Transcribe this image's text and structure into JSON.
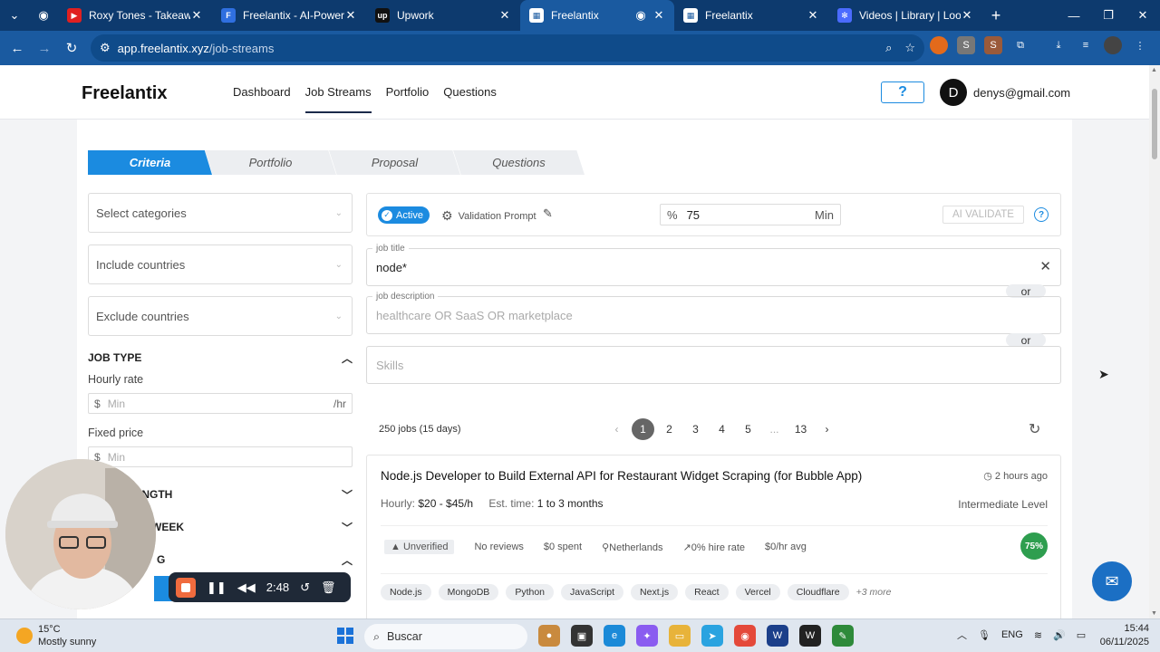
{
  "browser": {
    "tabs": [
      {
        "label": "Roxy Tones - Takeaways |",
        "icon": "youtube-icon",
        "color": "#e02020"
      },
      {
        "label": "Freelantix - AI-Powered U",
        "icon": "freelantix-doc-icon",
        "color": "#2f6fe0"
      },
      {
        "label": "Upwork",
        "icon": "upwork-icon",
        "color": "#111111"
      },
      {
        "label": "Freelantix",
        "icon": "freelantix-icon",
        "color": "#ffffff"
      },
      {
        "label": "Freelantix",
        "icon": "freelantix-icon",
        "color": "#ffffff"
      },
      {
        "label": "Videos | Library | Loom",
        "icon": "loom-icon",
        "color": "#4b6bff"
      }
    ],
    "url_host": "app.freelantix.xyz",
    "url_path": "/job-streams"
  },
  "header": {
    "logo": "Freelantix",
    "nav": [
      "Dashboard",
      "Job Streams",
      "Portfolio",
      "Questions"
    ],
    "help": "?",
    "avatar_initial": "D",
    "email": "denys@gmail.com"
  },
  "steps": [
    "Criteria",
    "Portfolio",
    "Proposal",
    "Questions"
  ],
  "filters": {
    "categories_placeholder": "Select categories",
    "include_countries": "Include countries",
    "exclude_countries": "Exclude countries",
    "job_type_heading": "JOB TYPE",
    "hourly_rate_label": "Hourly rate",
    "hourly_currency": "$",
    "hourly_placeholder": "Min",
    "hourly_unit": "/hr",
    "fixed_price_label": "Fixed price",
    "fixed_currency": "$",
    "fixed_placeholder": "Min",
    "length_heading": "LENGTH",
    "week_heading": "WEEK",
    "g_heading": "G"
  },
  "validation": {
    "active_label": "Active",
    "prompt_label": "Validation Prompt",
    "percent_symbol": "%",
    "percent_value": "75",
    "percent_unit": "Min",
    "ai_validate": "AI VALIDATE",
    "help": "?"
  },
  "fields": {
    "job_title_label": "job title",
    "job_title_value": "node*",
    "or_label": "or",
    "job_description_label": "job description",
    "job_description_placeholder": "healthcare OR SaaS OR marketplace",
    "skills_placeholder": "Skills"
  },
  "results": {
    "count": "250 jobs (15 days)",
    "pages": [
      "1",
      "2",
      "3",
      "4",
      "5",
      "...",
      "13"
    ],
    "current_page": "1"
  },
  "job": {
    "title": "Node.js Developer to Build External API for Restaurant Widget Scraping (for Bubble App)",
    "posted": "2 hours ago",
    "rate_label": "Hourly:",
    "rate_value": "$20 - $45/h",
    "est_label": "Est. time:",
    "est_value": "1 to 3 months",
    "level": "Intermediate Level",
    "unverified": "Unverified",
    "reviews": "No reviews",
    "spent": "$0 spent",
    "country": "Netherlands",
    "hire_rate": "0% hire rate",
    "avg": "$0/hr avg",
    "score": "75%",
    "skills": [
      "Node.js",
      "MongoDB",
      "Python",
      "JavaScript",
      "Next.js",
      "React",
      "Vercel",
      "Cloudflare"
    ],
    "more": "+3 more"
  },
  "recorder": {
    "time": "2:48"
  },
  "taskbar": {
    "temp": "15°C",
    "weather": "Mostly sunny",
    "search": "Buscar",
    "lang": "ENG",
    "time": "15:44",
    "date": "06/11/2025"
  }
}
